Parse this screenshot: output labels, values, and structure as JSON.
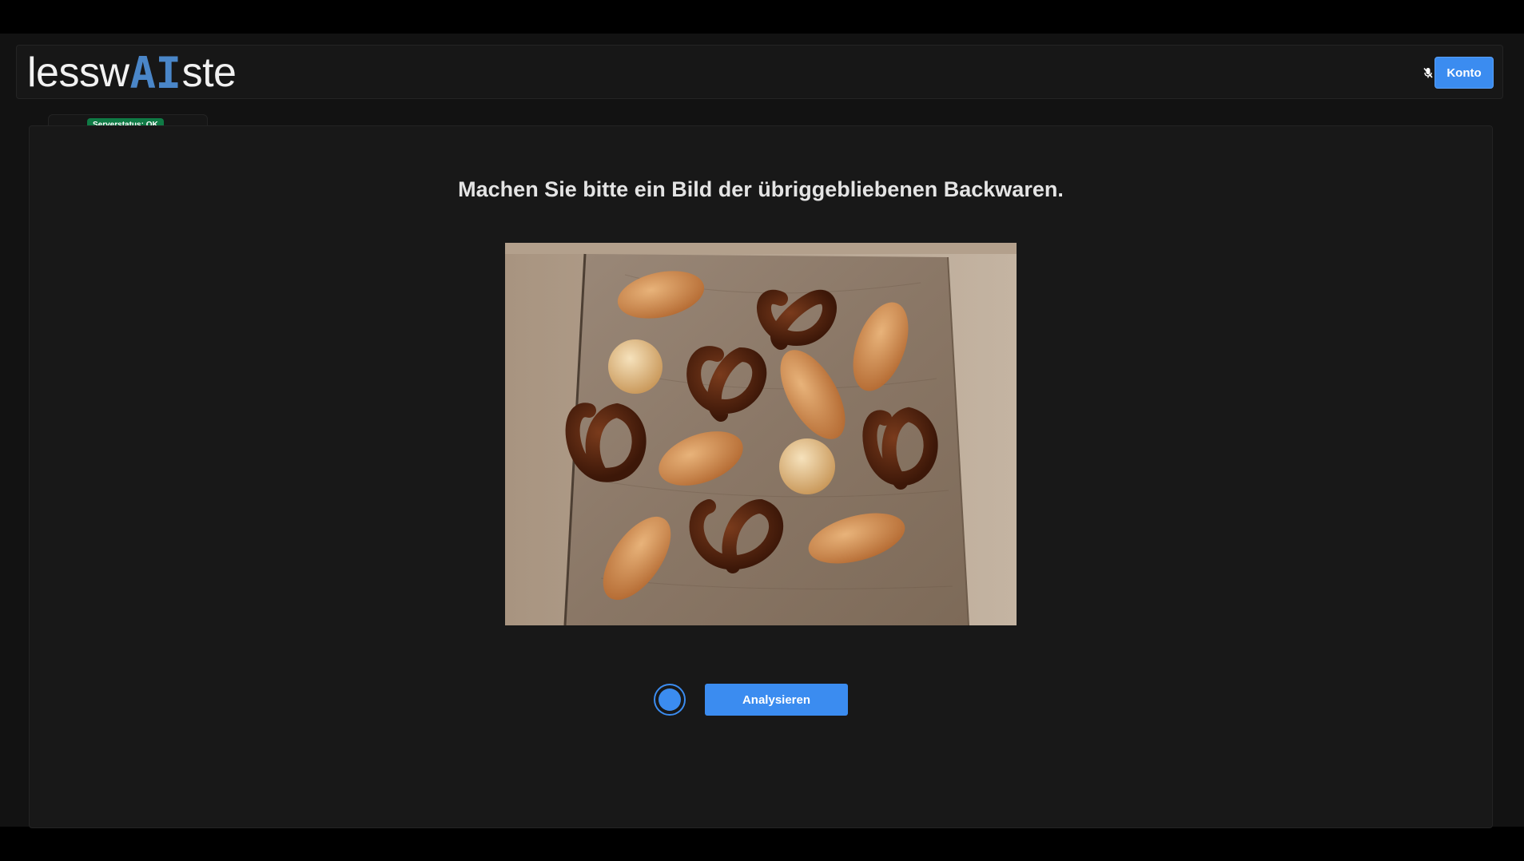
{
  "header": {
    "logo_prefix": "lessw",
    "logo_highlight": "AI",
    "logo_suffix": "ste",
    "mic_icon": "mic-off-icon",
    "account_button": "Konto"
  },
  "status": {
    "label": "Serverstatus: OK",
    "color": "#0f7a45"
  },
  "main": {
    "prompt": "Machen Sie bitte ein Bild der übriggebliebenen Backwaren.",
    "photo_subject": "baked goods on wooden table",
    "capture_icon": "capture-radio-icon",
    "analyze_button": "Analysieren"
  },
  "colors": {
    "accent": "#3b8cf0",
    "logo_accent": "#4a86c8",
    "background": "#181818"
  }
}
